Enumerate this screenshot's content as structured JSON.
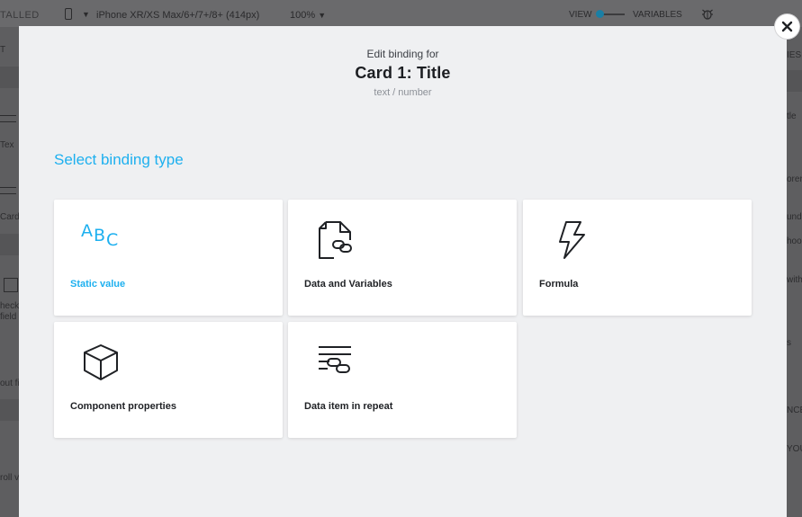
{
  "background": {
    "installed_label": "TALLED",
    "device_label": "iPhone XR/XS Max/6+/7+/8+ (414px)",
    "zoom_label": "100%",
    "view_label": "VIEW",
    "variables_label": "VARIABLES",
    "left_panel_texts": [
      "T",
      "Tex",
      "Card",
      "heckl",
      "field",
      "out fi",
      "roll v"
    ],
    "right_panel_texts": [
      "IES",
      "tle",
      "orer",
      "und",
      "hoo",
      "with",
      "s",
      "NCE",
      "YOU"
    ]
  },
  "modal": {
    "eyebrow": "Edit binding for",
    "title": "Card 1: Title",
    "subtitle": "text / number",
    "section_title": "Select binding type",
    "accent_color": "#1eb0ef",
    "options": [
      {
        "label": "Static value",
        "icon": "abc-icon",
        "selected": true,
        "glyphs": [
          "A",
          "B",
          "C"
        ]
      },
      {
        "label": "Data and Variables",
        "icon": "linked-document-icon",
        "selected": false
      },
      {
        "label": "Formula",
        "icon": "lightning-icon",
        "selected": false
      },
      {
        "label": "Component properties",
        "icon": "cube-icon",
        "selected": false
      },
      {
        "label": "Data item in repeat",
        "icon": "repeat-link-icon",
        "selected": false
      }
    ]
  }
}
